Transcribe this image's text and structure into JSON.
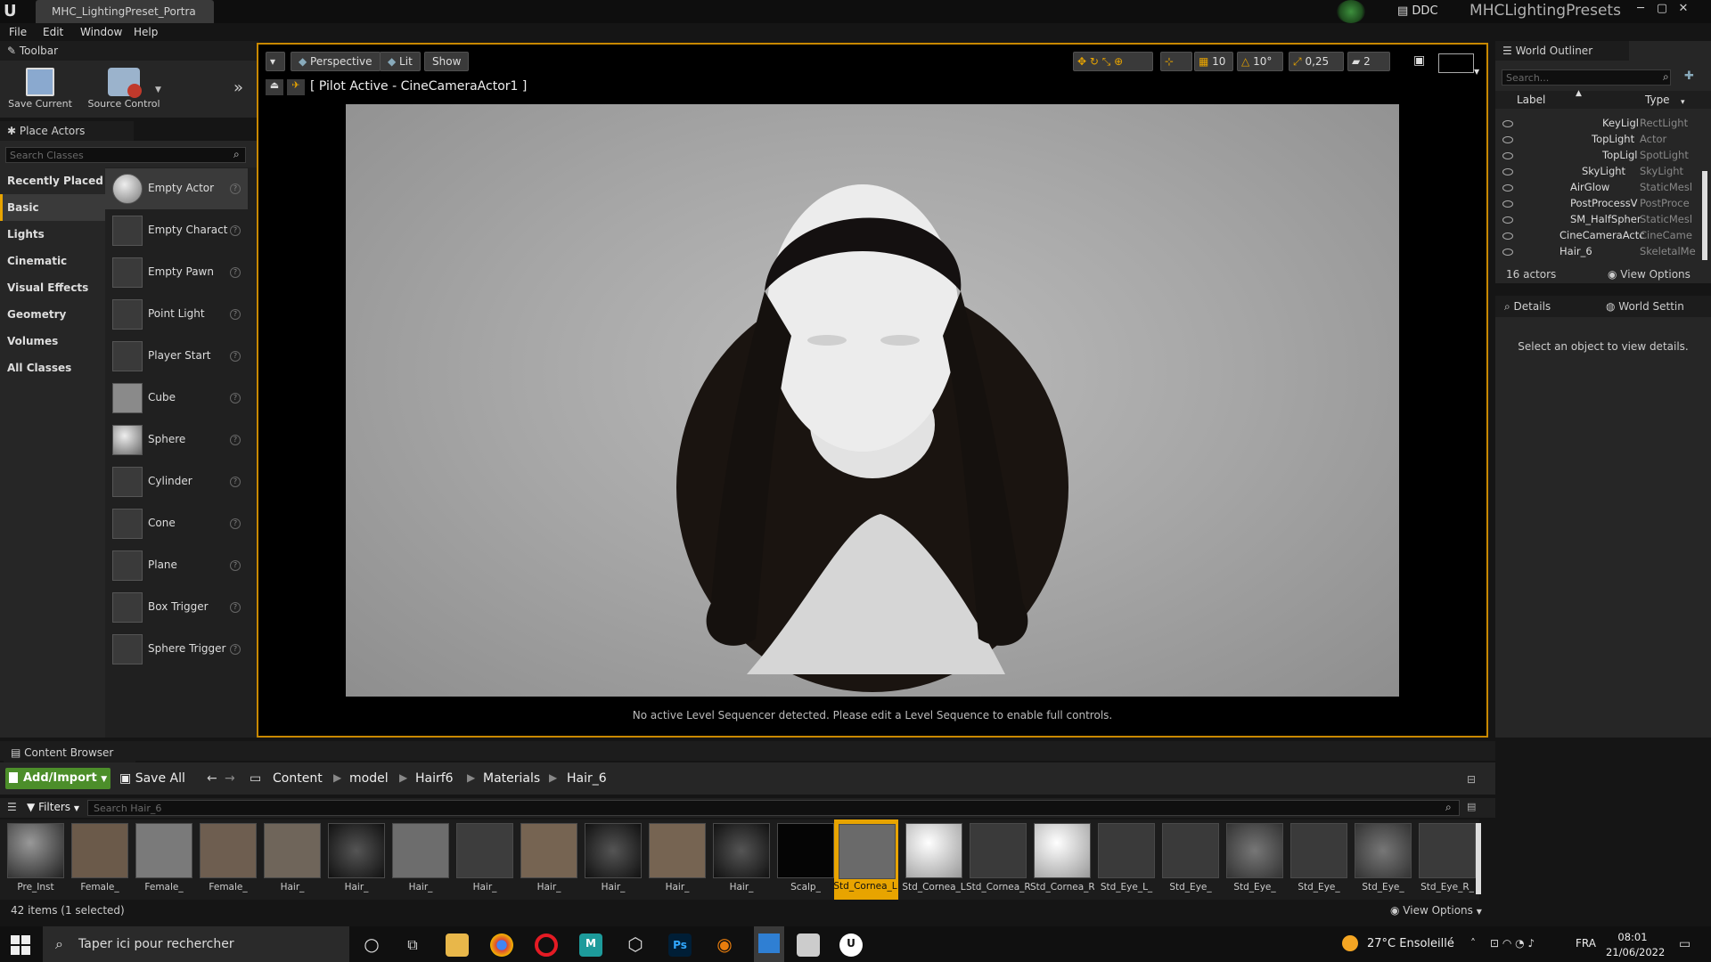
{
  "window": {
    "doc_tab": "MHC_LightingPreset_Portra",
    "ddc_label": "DDC",
    "project_name": "MHCLightingPresets"
  },
  "menu": [
    "File",
    "Edit",
    "Window",
    "Help"
  ],
  "toolbar": {
    "title": "Toolbar",
    "save_label": "Save Current",
    "source_control_label": "Source Control"
  },
  "place_actors": {
    "title": "Place Actors",
    "search_placeholder": "Search Classes",
    "categories": [
      "Recently Placed",
      "Basic",
      "Lights",
      "Cinematic",
      "Visual Effects",
      "Geometry",
      "Volumes",
      "All Classes"
    ],
    "items": [
      "Empty Actor",
      "Empty Charact",
      "Empty Pawn",
      "Point Light",
      "Player Start",
      "Cube",
      "Sphere",
      "Cylinder",
      "Cone",
      "Plane",
      "Box Trigger",
      "Sphere Trigger"
    ]
  },
  "viewport": {
    "perspective_label": "Perspective",
    "lit_label": "Lit",
    "show_label": "Show",
    "grid_snap": "10",
    "rot_snap": "10°",
    "scale_snap": "0,25",
    "camera_speed": "2",
    "pilot_text": "[ Pilot Active - CineCameraActor1 ]",
    "sequencer_message": "No active Level Sequencer detected. Please edit a Level Sequence to enable full controls."
  },
  "outliner": {
    "title": "World Outliner",
    "search_placeholder": "Search...",
    "col_label": "Label",
    "col_type": "Type",
    "rows": [
      {
        "label": "KeyLigl",
        "type": "RectLight"
      },
      {
        "label": "TopLight",
        "type": "Actor"
      },
      {
        "label": "TopLigl",
        "type": "SpotLight"
      },
      {
        "label": "SkyLight",
        "type": "SkyLight"
      },
      {
        "label": "AirGlow",
        "type": "StaticMesl"
      },
      {
        "label": "PostProcessV",
        "type": "PostProce"
      },
      {
        "label": "SM_HalfSpher",
        "type": "StaticMesl"
      },
      {
        "label": "CineCameraActc",
        "type": "CineCame"
      },
      {
        "label": "Hair_6",
        "type": "SkeletalMe"
      }
    ],
    "actor_count": "16 actors",
    "view_options": "View Options"
  },
  "details": {
    "tab_details": "Details",
    "tab_world": "World Settin",
    "empty_message": "Select an object to view details."
  },
  "content_browser": {
    "title": "Content Browser",
    "add_import": "Add/Import",
    "save_all": "Save All",
    "breadcrumb": [
      "Content",
      "model",
      "Hairf6",
      "Materials",
      "Hair_6"
    ],
    "filters_label": "Filters",
    "search_placeholder": "Search Hair_6",
    "assets": [
      "Pre_Inst",
      "Female_",
      "Female_",
      "Female_",
      "Hair_",
      "Hair_",
      "Hair_",
      "Hair_",
      "Hair_",
      "Hair_",
      "Hair_",
      "Hair_",
      "Scalp_",
      "Std_Cornea_L",
      "Std_Cornea_L",
      "Std_Cornea_R",
      "Std_Cornea_R",
      "Std_Eye_L_",
      "Std_Eye_",
      "Std_Eye_",
      "Std_Eye_",
      "Std_Eye_",
      "Std_Eye_R_"
    ],
    "status": "42 items (1 selected)",
    "view_options": "View Options"
  },
  "taskbar": {
    "search_text": "Taper ici pour rechercher",
    "weather": "27°C Ensoleillé",
    "lang": "FRA",
    "time": "08:01",
    "date": "21/06/2022"
  }
}
